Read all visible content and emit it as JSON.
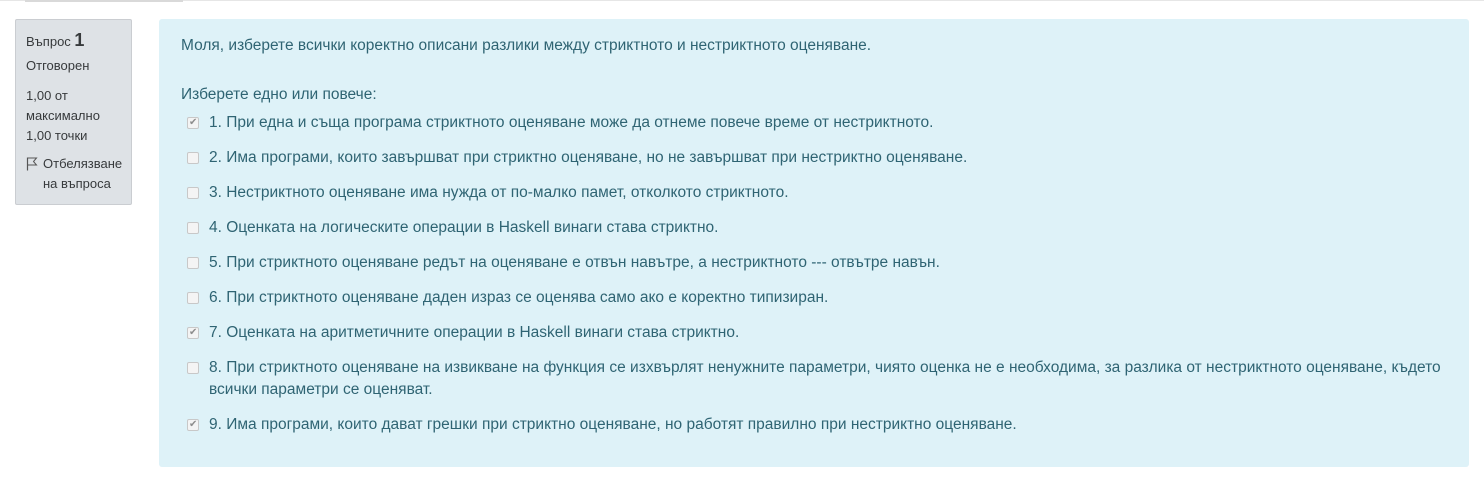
{
  "info": {
    "question_label": "Въпрос",
    "question_number": "1",
    "state": "Отговорен",
    "grade_line1": "1,00 от",
    "grade_line2": "максимално",
    "grade_line3": "1,00 точки",
    "flag_line1": "Отбелязване",
    "flag_line2": "на въпроса",
    "flag_icon": "flag-icon"
  },
  "question": {
    "text": "Моля, изберете всички коректно описани разлики между стриктното и нестриктното оценяване.",
    "prompt": "Изберете едно или повече:",
    "answers": [
      {
        "label": "1. При една и съща програма стриктното оценяване може да отнеме повече време от нестриктното.",
        "checked": true
      },
      {
        "label": "2. Има програми, които завършват при стриктно оценяване, но не завършват при нестриктно оценяване.",
        "checked": false
      },
      {
        "label": "3. Нестриктното оценяване има нужда от по-малко памет, отколкото стриктното.",
        "checked": false
      },
      {
        "label": "4. Оценката на логическите операции в Haskell винаги става стриктно.",
        "checked": false
      },
      {
        "label": "5. При стриктното оценяване редът на оценяване е отвън навътре, а нестриктното --- отвътре навън.",
        "checked": false
      },
      {
        "label": "6. При стриктното оценяване даден израз се оценява само ако е коректно типизиран.",
        "checked": false
      },
      {
        "label": "7. Оценката на аритметичните операции в Haskell винаги става стриктно.",
        "checked": true
      },
      {
        "label": "8. При стриктното оценяване на извикване на функция се изхвърлят ненужните параметри, чиято оценка не е необходима, за разлика от нестриктното оценяване, където всички параметри се оценяват.",
        "checked": false
      },
      {
        "label": "9. Има програми, които дават грешки при стриктно оценяване, но работят правилно при нестриктно оценяване.",
        "checked": true
      }
    ]
  }
}
